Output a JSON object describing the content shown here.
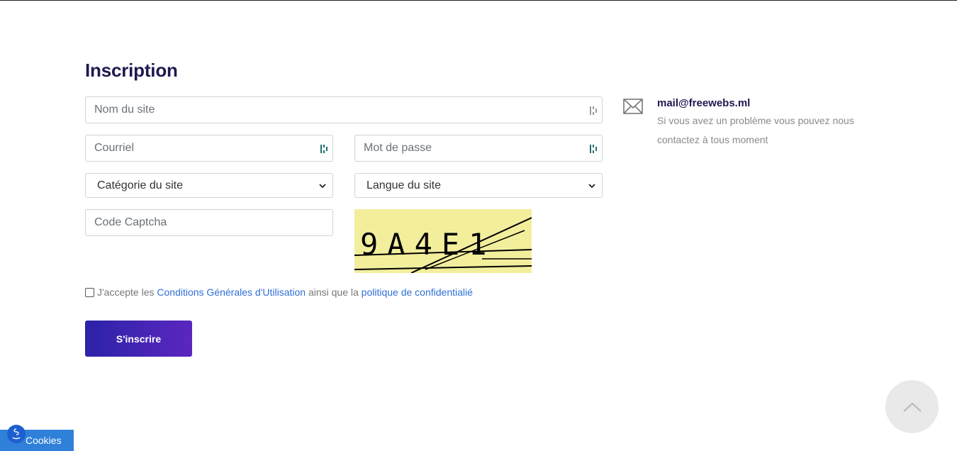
{
  "form": {
    "title": "Inscription",
    "site_name_placeholder": "Nom du site",
    "email_placeholder": "Courriel",
    "password_placeholder": "Mot de passe",
    "category_select": "Catégorie du site",
    "language_select": "Langue du site",
    "captcha_placeholder": "Code Captcha",
    "captcha_text": "9A4E1",
    "terms": {
      "prefix": "J'accepte les",
      "link1": "Conditions Générales d'Utilisation",
      "middle": "ainsi que la",
      "link2": "politique de confidentialié"
    },
    "submit_label": "S'inscrire"
  },
  "contact": {
    "email": "mail@freewebs.ml",
    "description": "Si vous avez un problème vous pouvez nous contactez à tous moment",
    "icon": "envelope-icon"
  },
  "cookies": {
    "label": "Cookies"
  },
  "colors": {
    "title": "#1d1950",
    "link": "#2f6fd6",
    "button_gradient_start": "#2c22a8",
    "button_gradient_end": "#5b27bf",
    "captcha_bg": "#f3ee9c",
    "cookie_bar": "#2f80d8"
  }
}
